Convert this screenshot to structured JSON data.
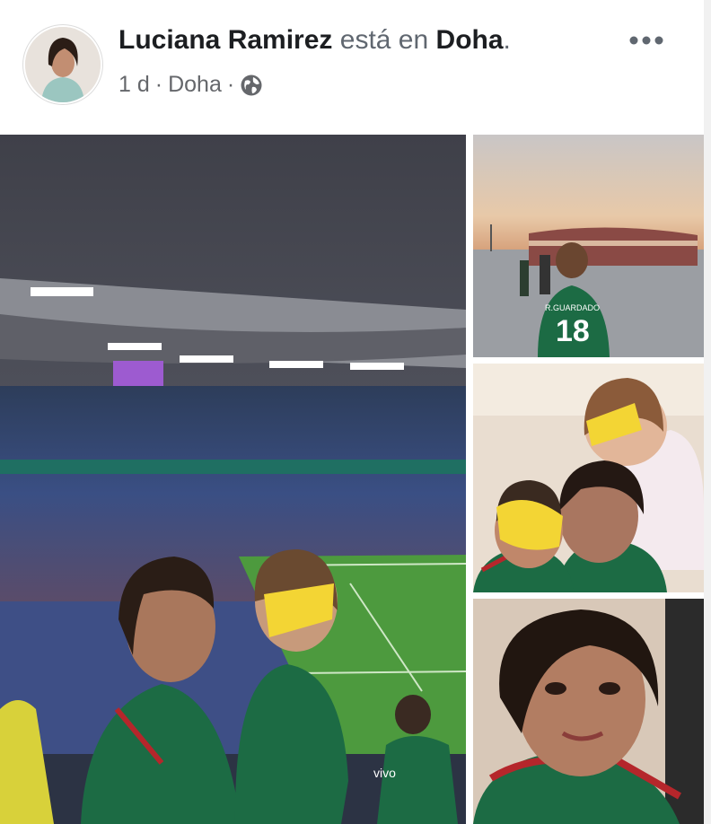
{
  "post": {
    "author": "Luciana Ramirez",
    "verb": "está en",
    "place": "Doha",
    "punct": ".",
    "time": "1 d",
    "sep1": "·",
    "location": "Doha",
    "sep2": "·",
    "more_icon": "more-dots-icon",
    "audience_icon": "globe-icon"
  },
  "photos": {
    "jersey_text": "18",
    "jersey_name": "R.GUARDADO",
    "board_text": "vivo"
  },
  "colors": {
    "mexico_green": "#1c6b44",
    "pitch_green": "#4d9a3e",
    "blur_yellow": "#f3d534"
  }
}
